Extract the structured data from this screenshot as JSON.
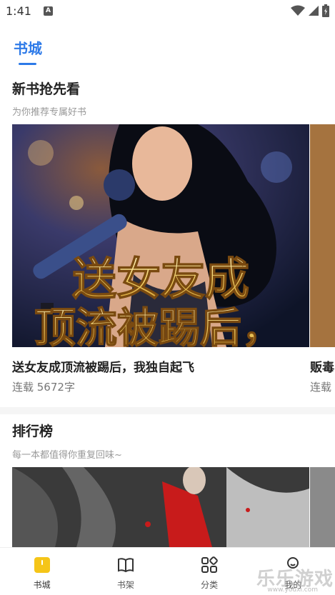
{
  "status_bar": {
    "time": "1:41",
    "notif_icon": "A"
  },
  "top_tabs": [
    {
      "label": "书城",
      "active": true
    }
  ],
  "new_books": {
    "title": "新书抢先看",
    "subtitle": "为你推荐专属好书",
    "books": [
      {
        "title": "送女友成顶流被踢后，我独自起飞",
        "meta": "连载 5672字",
        "cover_text_line1": "送女友成",
        "cover_text_line2": "顶流被踢后，"
      },
      {
        "title": "贩毒",
        "meta": "连载"
      }
    ]
  },
  "ranking": {
    "title": "排行榜",
    "subtitle": "每一本都值得你重复回味~"
  },
  "bottom_nav": [
    {
      "label": "书城",
      "icon": "bookstore-icon",
      "active": true,
      "color": "#f5c518"
    },
    {
      "label": "书架",
      "icon": "bookshelf-icon",
      "active": false
    },
    {
      "label": "分类",
      "icon": "category-icon",
      "active": false
    },
    {
      "label": "我的",
      "icon": "profile-icon",
      "active": false
    }
  ],
  "watermark": {
    "text": "乐乐游戏",
    "sub": "www.youxi.com"
  },
  "colors": {
    "accent": "#2d7ae8",
    "active_nav": "#f5c518"
  }
}
